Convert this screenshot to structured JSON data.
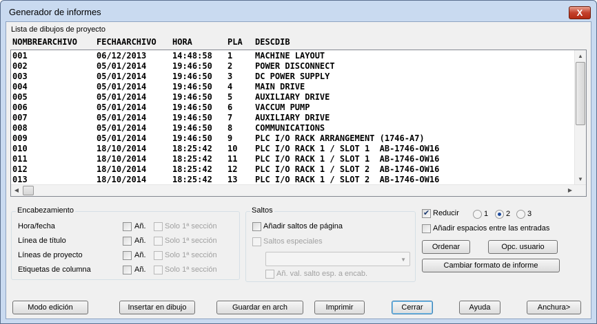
{
  "window": {
    "title": "Generador de informes",
    "close_symbol": "X"
  },
  "list": {
    "label": "Lista de dibujos de proyecto",
    "columns": [
      "NOMBREARCHIVO",
      "FECHAARCHIVO",
      "HORA",
      "PLA",
      "DESCDIB"
    ],
    "rows": [
      [
        "001",
        "06/12/2013",
        "14:48:58",
        "1",
        "MACHINE LAYOUT"
      ],
      [
        "002",
        "05/01/2014",
        "19:46:50",
        "2",
        "POWER DISCONNECT"
      ],
      [
        "003",
        "05/01/2014",
        "19:46:50",
        "3",
        "DC POWER SUPPLY"
      ],
      [
        "004",
        "05/01/2014",
        "19:46:50",
        "4",
        "MAIN DRIVE"
      ],
      [
        "005",
        "05/01/2014",
        "19:46:50",
        "5",
        "AUXILIARY DRIVE"
      ],
      [
        "006",
        "05/01/2014",
        "19:46:50",
        "6",
        "VACCUM PUMP"
      ],
      [
        "007",
        "05/01/2014",
        "19:46:50",
        "7",
        "AUXILIARY DRIVE"
      ],
      [
        "008",
        "05/01/2014",
        "19:46:50",
        "8",
        "COMMUNICATIONS"
      ],
      [
        "009",
        "05/01/2014",
        "19:46:50",
        "9",
        "PLC I/O RACK ARRANGEMENT (1746-A7)"
      ],
      [
        "010",
        "18/10/2014",
        "18:25:42",
        "10",
        "PLC I/O RACK 1 / SLOT 1  AB-1746-OW16"
      ],
      [
        "011",
        "18/10/2014",
        "18:25:42",
        "11",
        "PLC I/O RACK 1 / SLOT 1  AB-1746-OW16"
      ],
      [
        "012",
        "18/10/2014",
        "18:25:42",
        "12",
        "PLC I/O RACK 1 / SLOT 2  AB-1746-OW16"
      ],
      [
        "013",
        "18/10/2014",
        "18:25:42",
        "13",
        "PLC I/O RACK 1 / SLOT 2  AB-1746-OW16"
      ]
    ]
  },
  "encabezamiento": {
    "title": "Encabezamiento",
    "rows": [
      {
        "label": "Hora/fecha",
        "an": "Añ.",
        "solo": "Solo 1ª sección"
      },
      {
        "label": "Línea de título",
        "an": "Añ.",
        "solo": "Solo 1ª sección"
      },
      {
        "label": "Líneas de proyecto",
        "an": "Añ.",
        "solo": "Solo 1ª sección"
      },
      {
        "label": "Etiquetas de columna",
        "an": "Añ.",
        "solo": "Solo 1ª sección"
      }
    ]
  },
  "saltos": {
    "title": "Saltos",
    "page_breaks": "Añadir saltos de página",
    "special_breaks": "Saltos especiales",
    "combo_value": "",
    "header_value": "Añ. val. salto esp. a encab."
  },
  "options": {
    "reducir": "Reducir",
    "reducir_checked": true,
    "radios": [
      "1",
      "2",
      "3"
    ],
    "selected_radio": "2",
    "spaces": "Añadir espacios entre las entradas",
    "ordenar": "Ordenar",
    "opc_usuario": "Opc. usuario",
    "cambiar_formato": "Cambiar formato de informe"
  },
  "bottom_buttons": {
    "modo_edicion": "Modo edición",
    "insertar": "Insertar en dibujo",
    "guardar": "Guardar en arch",
    "imprimir": "Imprimir",
    "cerrar": "Cerrar",
    "ayuda": "Ayuda",
    "anchura": "Anchura>"
  }
}
